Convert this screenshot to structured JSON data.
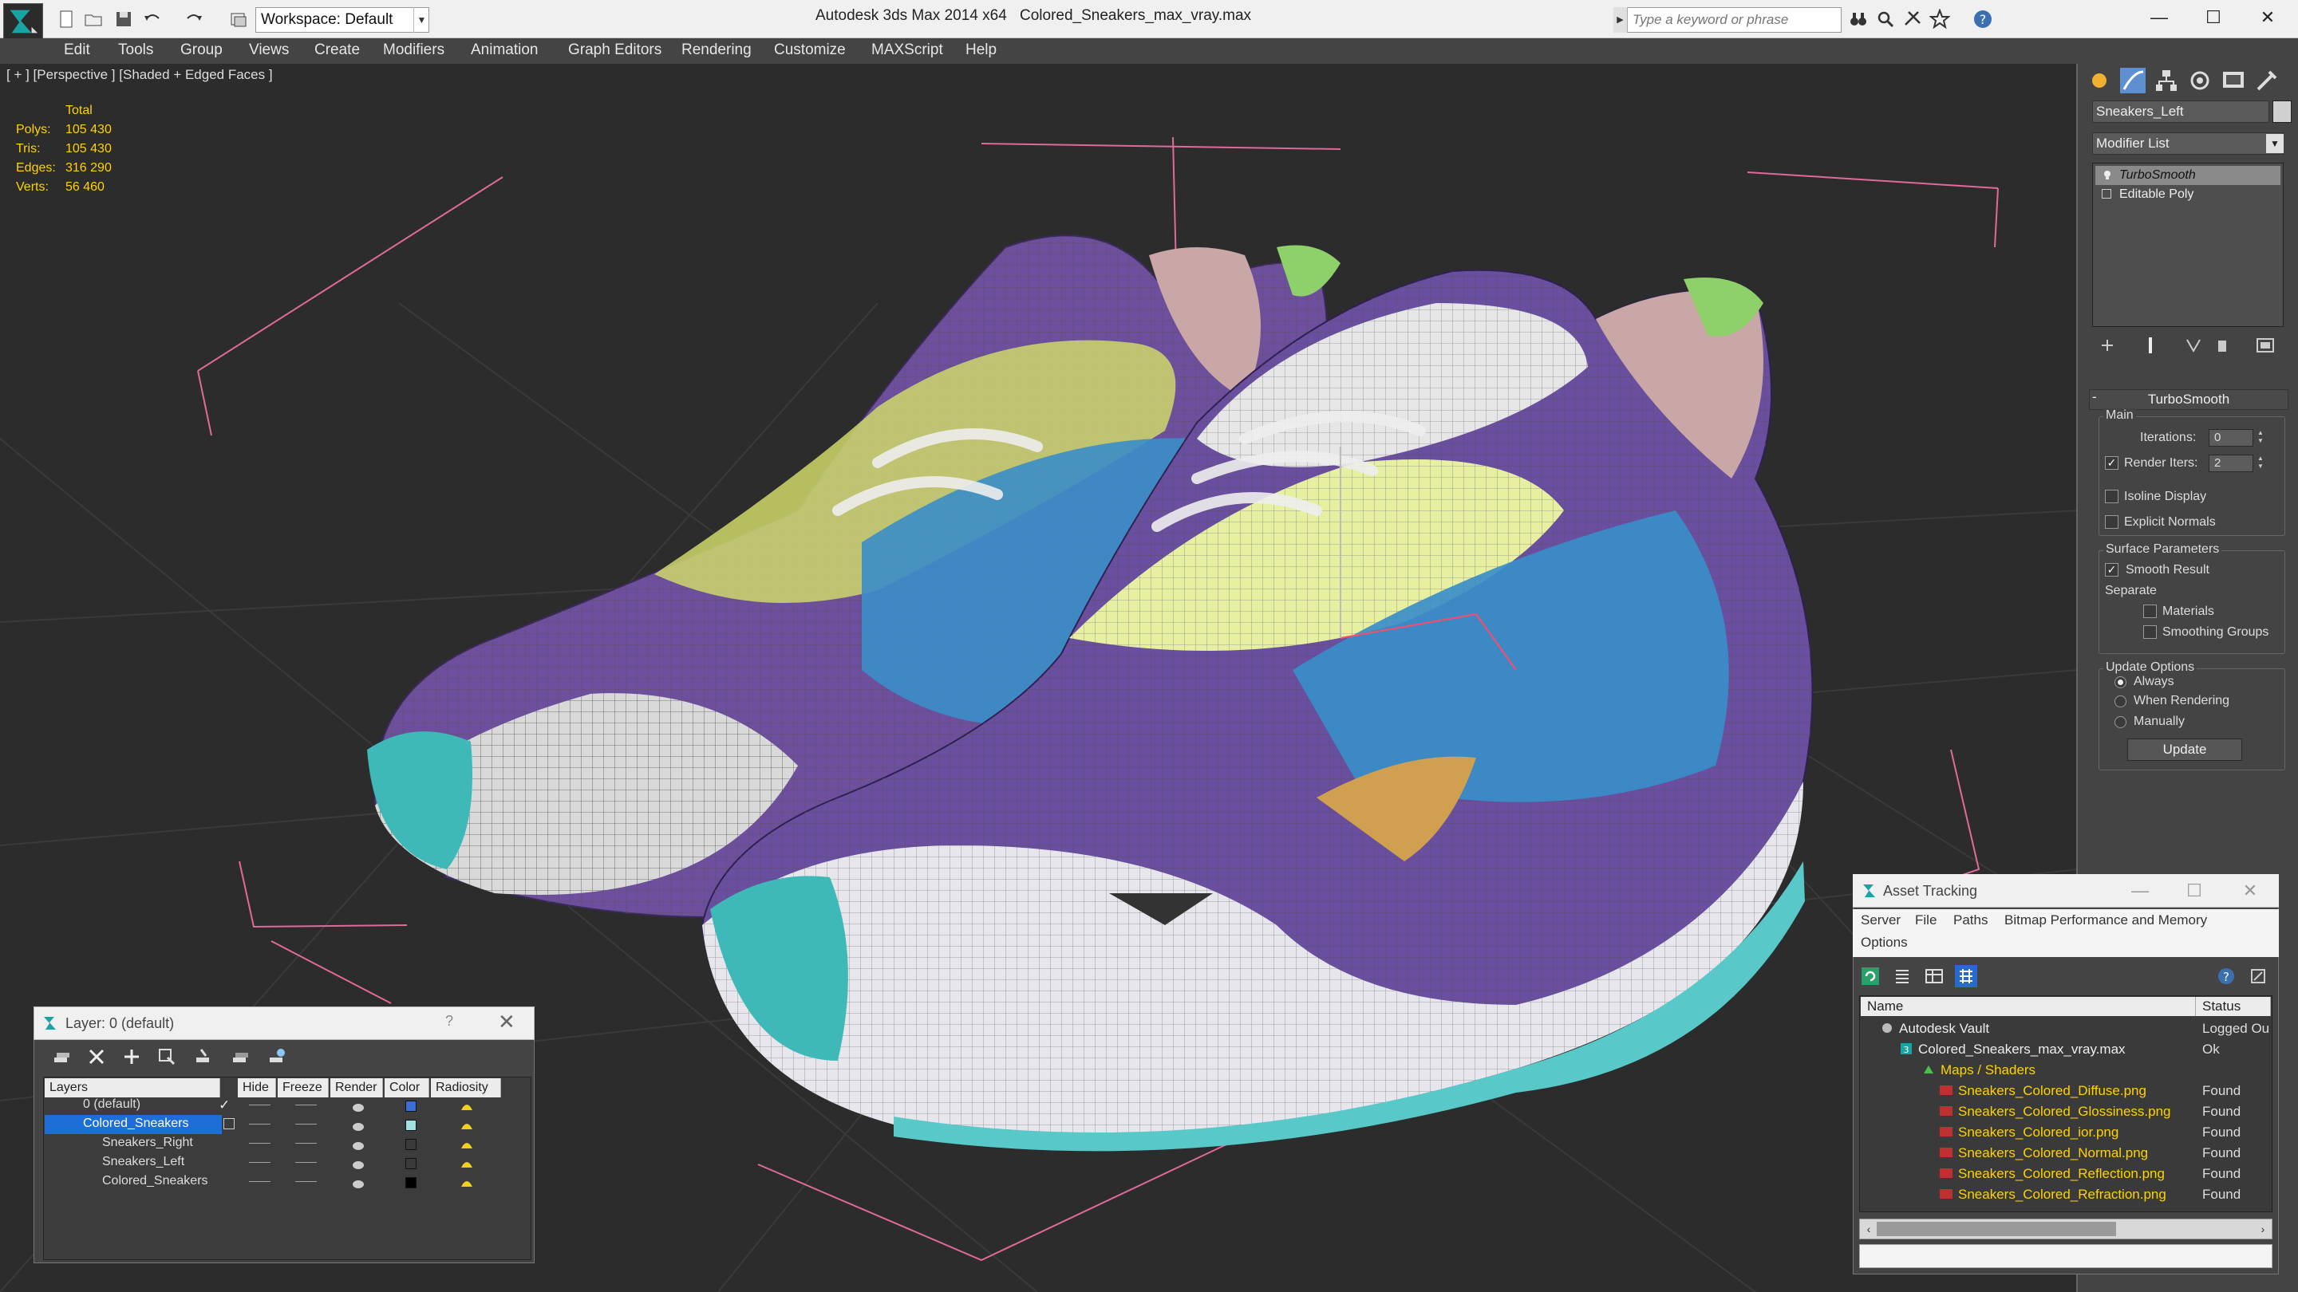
{
  "titlebar": {
    "workspace": "Workspace: Default",
    "app_title": "Autodesk 3ds Max  2014 x64",
    "file_title": "Colored_Sneakers_max_vray.max",
    "search_placeholder": "Type a keyword or phrase",
    "window_controls": [
      "—",
      "☐",
      "✕"
    ]
  },
  "menu": [
    "Edit",
    "Tools",
    "Group",
    "Views",
    "Create",
    "Modifiers",
    "Animation",
    "Graph Editors",
    "Rendering",
    "Customize",
    "MAXScript",
    "Help"
  ],
  "viewport": {
    "label": "[ + ] [Perspective ] [Shaded + Edged Faces ]",
    "stats_header": "Total",
    "stats": [
      {
        "label": "Polys:",
        "value": "105 430"
      },
      {
        "label": "Tris:",
        "value": "105 430"
      },
      {
        "label": "Edges:",
        "value": "316 290"
      },
      {
        "label": "Verts:",
        "value": "56 460"
      }
    ]
  },
  "command_panel": {
    "object_name": "Sneakers_Left",
    "modifier_list": "Modifier List",
    "stack": [
      "TurboSmooth",
      "Editable Poly"
    ],
    "rollout_title": "TurboSmooth",
    "main_group": "Main",
    "iterations_label": "Iterations:",
    "iterations_value": "0",
    "render_iters_label": "Render Iters:",
    "render_iters_value": "2",
    "isoline_label": "Isoline Display",
    "explicit_normals_label": "Explicit Normals",
    "surface_group": "Surface Parameters",
    "smooth_result_label": "Smooth Result",
    "separate_label": "Separate",
    "materials_label": "Materials",
    "smoothing_groups_label": "Smoothing Groups",
    "update_group": "Update Options",
    "always_label": "Always",
    "when_rendering_label": "When Rendering",
    "manually_label": "Manually",
    "update_button": "Update",
    "check_mark": "✓"
  },
  "layer_dialog": {
    "title": "Layer: 0 (default)",
    "help": "?",
    "close": "✕",
    "columns": [
      "Layers",
      "Hide",
      "Freeze",
      "Render",
      "Color",
      "Radiosity"
    ],
    "rows": [
      {
        "name": "0 (default)",
        "color": "#3a6fd8"
      },
      {
        "name": "Colored_Sneakers",
        "color": "#9fe0e0"
      },
      {
        "name": "Sneakers_Right",
        "color": "#3a3a3a"
      },
      {
        "name": "Sneakers_Left",
        "color": "#3a3a3a"
      },
      {
        "name": "Colored_Sneakers",
        "color": "#000000"
      }
    ]
  },
  "asset_dialog": {
    "title": "Asset Tracking",
    "menu": [
      "Server",
      "File",
      "Paths",
      "Bitmap Performance and Memory",
      "Options"
    ],
    "columns": [
      "Name",
      "Status"
    ],
    "rows": [
      {
        "name": "Autodesk Vault",
        "status": "Logged Ou"
      },
      {
        "name": "Colored_Sneakers_max_vray.max",
        "status": "Ok"
      },
      {
        "name": "Maps / Shaders",
        "status": ""
      },
      {
        "name": "Sneakers_Colored_Diffuse.png",
        "status": "Found"
      },
      {
        "name": "Sneakers_Colored_Glossiness.png",
        "status": "Found"
      },
      {
        "name": "Sneakers_Colored_ior.png",
        "status": "Found"
      },
      {
        "name": "Sneakers_Colored_Normal.png",
        "status": "Found"
      },
      {
        "name": "Sneakers_Colored_Reflection.png",
        "status": "Found"
      },
      {
        "name": "Sneakers_Colored_Refraction.png",
        "status": "Found"
      }
    ]
  },
  "colors": {
    "selection_blue": "#1e6ed8",
    "stat_yellow": "#ffd200",
    "bounding_box_pink": "#e06a9a",
    "link_red": "#ff4a6a"
  }
}
